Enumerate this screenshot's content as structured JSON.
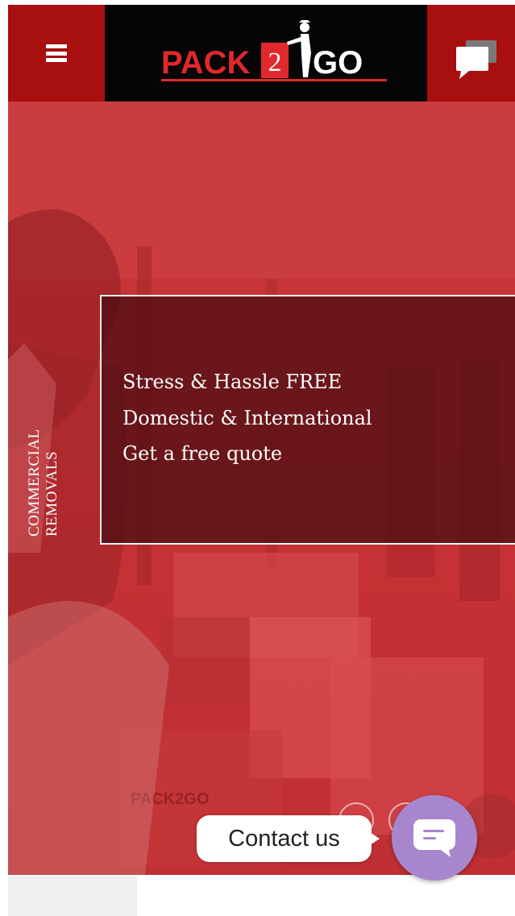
{
  "header": {
    "logo": {
      "part1": "PACK",
      "number": "2",
      "part2": "GO"
    },
    "menu_icon": "hamburger-icon",
    "chat_icon": "chat-bubbles-icon"
  },
  "hero": {
    "lines": [
      "Stress & Hassle FREE",
      "Domestic & International",
      "Get a free quote"
    ],
    "vertical_label": [
      "COMMERCIAL",
      "REMOVALS"
    ],
    "box_logo": "PACK2GO"
  },
  "contact": {
    "label": "Contact us",
    "icon": "chat-icon"
  },
  "colors": {
    "brand_red": "#a80f0f",
    "hero_red": "#c63336",
    "logo_bg": "#050505",
    "fab_purple": "#a886cd"
  }
}
